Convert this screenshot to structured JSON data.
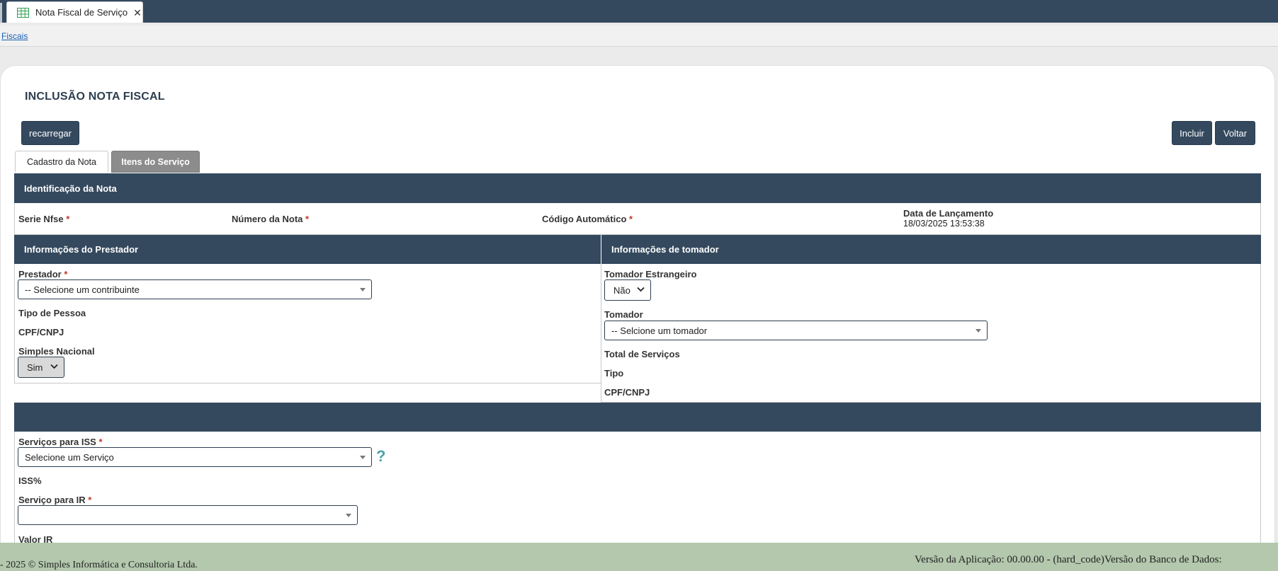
{
  "window_tab": {
    "title": "Nota Fiscal de Serviço",
    "icon": "spreadsheet-icon",
    "close_glyph": "✕"
  },
  "breadcrumb": {
    "link": "Fiscais"
  },
  "page": {
    "title": "INCLUSÃO NOTA FISCAL"
  },
  "toolbar": {
    "reload_label": "recarregar",
    "include_label": "Incluir",
    "back_label": "Voltar"
  },
  "tabs": [
    {
      "label": "Cadastro da Nota",
      "active": true
    },
    {
      "label": "Itens do Serviço",
      "active": false
    }
  ],
  "identificacao": {
    "header": "Identificação da Nota",
    "serie_label": "Serie Nfse",
    "numero_label": "Número da Nota",
    "codigo_label": "Código Automático",
    "data_label": "Data de Lançamento",
    "data_value": "18/03/2025 13:53:38",
    "required_mark": "*"
  },
  "prestador": {
    "header": "Informações do Prestador",
    "prestador_label": "Prestador",
    "prestador_value": "-- Selecione um contribuinte",
    "tipo_pessoa_label": "Tipo de Pessoa",
    "cpf_label": "CPF/CNPJ",
    "simples_label": "Simples Nacional",
    "simples_value": "Sim"
  },
  "tomador": {
    "header": "Informações de tomador",
    "estrangeiro_label": "Tomador Estrangeiro",
    "estrangeiro_value": "Não",
    "tomador_label": "Tomador",
    "tomador_value": "-- Selcione um tomador",
    "total_label": "Total de Serviços",
    "tipo_label": "Tipo",
    "cpf_label": "CPF/CNPJ"
  },
  "servicos": {
    "iss_label": "Serviços para ISS",
    "iss_value": "Selecione um Serviço",
    "help_glyph": "?",
    "iss_percent_label": "ISS%",
    "ir_label": "Serviço para IR",
    "ir_value": "",
    "valor_ir_label": "Valor IR"
  },
  "footer": {
    "copyright": "- 2025 © Simples Informática e Consultoria Ltda.",
    "version": "Versão da Aplicação: 00.00.00 - (hard_code)Versão do Banco de Dados:"
  },
  "colors": {
    "header_bg": "#34495e",
    "footer_bg": "#b3c8ad",
    "required": "#c0392b",
    "help": "#4ea3a8"
  }
}
